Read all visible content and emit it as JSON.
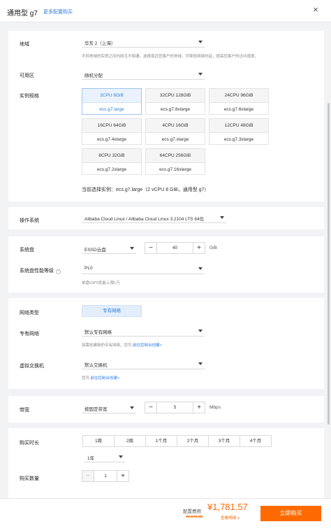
{
  "header": {
    "title": "通用型 g7",
    "more_link": "更多配置购买",
    "close_icon": "×"
  },
  "region": {
    "label": "地域",
    "value": "华东 2（上海）",
    "hint": "不同地域的实例之间内网互不相通，选择靠近您客户的地域，可降低网络时延，提高您客户的访问速度。"
  },
  "zone": {
    "label": "可用区",
    "value": "随机分配"
  },
  "instance": {
    "label": "实例规格",
    "specs": [
      {
        "cpu": "2CPU 8GiB",
        "type": "ecs.g7.large"
      },
      {
        "cpu": "32CPU 128GiB",
        "type": "ecs.g7.8xlarge"
      },
      {
        "cpu": "24CPU 96GiB",
        "type": "ecs.g7.6xlarge"
      },
      {
        "cpu": "16CPU 64GiB",
        "type": "ecs.g7.4xlarge"
      },
      {
        "cpu": "4CPU 16GiB",
        "type": "ecs.g7.xlarge"
      },
      {
        "cpu": "12CPU 48GiB",
        "type": "ecs.g7.3xlarge"
      },
      {
        "cpu": "8CPU 32GiB",
        "type": "ecs.g7.2xlarge"
      },
      {
        "cpu": "64CPU 256GiB",
        "type": "ecs.g7.16xlarge"
      }
    ],
    "current": "当前选择实例：ecs.g7.large（2 vCPU 8 GiB，通用型 g7）"
  },
  "os": {
    "label": "操作系统",
    "value": "Alibaba Cloud Linux / Alibaba Cloud Linux 3.2104 LTS 64位"
  },
  "disk": {
    "label": "系统盘",
    "type": "ESSD云盘",
    "size": "40",
    "unit": "GiB"
  },
  "perf": {
    "label": "系统盘性能等级",
    "value": "PL0",
    "hint": "单盘IOPS性能上限1万"
  },
  "network": {
    "type_label": "网络类型",
    "type_value": "专有网络",
    "vpc_label": "专有网络",
    "vpc_value": "默认专有网络",
    "vpc_hint_pre": "如需创建新的专有网络，您可",
    "vpc_hint_link": "前往控制台创建>",
    "vswitch_label": "虚拟交换机",
    "vswitch_value": "默认交换机",
    "vswitch_hint_pre": "您可",
    "vswitch_hint_link": "前往控制台创建>"
  },
  "bandwidth": {
    "label": "带宽",
    "mode": "按固定带宽",
    "value": "5",
    "unit": "Mbps"
  },
  "duration": {
    "label": "购买时长",
    "options": [
      "1周",
      "2周",
      "1个月",
      "2个月",
      "3个月",
      "4个月"
    ],
    "year_value": "1年"
  },
  "quantity": {
    "label": "购买数量",
    "value": "1"
  },
  "footer": {
    "fee_label": "配置费用",
    "price": "¥1,781.57",
    "original": "¥2,972.35",
    "detail": "查看明细 ∨",
    "buy": "立即购买"
  },
  "colors": {
    "accent": "#2d7fe0",
    "orange": "#ff6a00"
  }
}
